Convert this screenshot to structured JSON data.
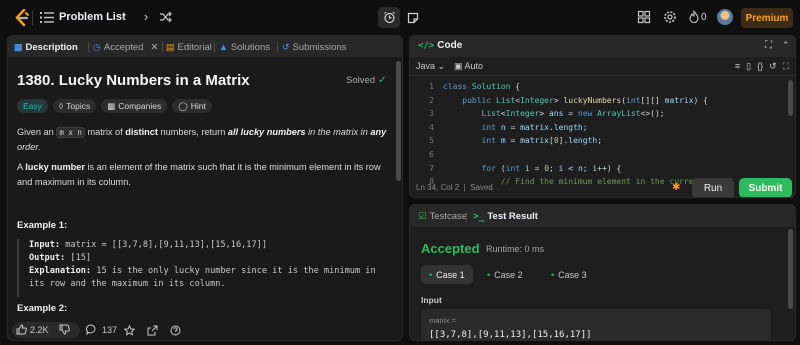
{
  "topbar": {
    "problem_list": "Problem List",
    "fire_count": "0",
    "premium": "Premium"
  },
  "left": {
    "tabs": [
      {
        "label": "Description",
        "icon": "description-icon"
      },
      {
        "label": "Accepted",
        "icon": "clock-icon"
      },
      {
        "label": "Editorial",
        "icon": "book-icon"
      },
      {
        "label": "Solutions",
        "icon": "flask-icon"
      },
      {
        "label": "Submissions",
        "icon": "history-icon"
      }
    ],
    "title": "1380. Lucky Numbers in a Matrix",
    "solved": "Solved",
    "chips": [
      "Easy",
      "Topics",
      "Companies",
      "Hint"
    ],
    "desc1": {
      "a": "Given an ",
      "code": "m x n",
      "b": " matrix of ",
      "bold1": "distinct",
      "c": " numbers, return ",
      "it1": "all",
      "bold2": "lucky numbers",
      "d": " in the matrix in ",
      "bold3": "any",
      "e": "order."
    },
    "desc2": {
      "a": "A ",
      "bold": "lucky number",
      "b": " is an element of the matrix such that it is the minimum element in its row and maximum in its column."
    },
    "example1": {
      "title": "Example 1:",
      "input_label": "Input:",
      "input_value": " matrix = [[3,7,8],[9,11,13],[15,16,17]]",
      "output_label": "Output:",
      "output_value": " [15]",
      "expl_label": "Explanation:",
      "expl_value": " 15 is the only lucky number since it is the minimum in",
      "expl_value2": "its row and the maximum in its column."
    },
    "example2_title": "Example 2:",
    "footer": {
      "likes": "2.2K",
      "comments": "137"
    }
  },
  "code": {
    "title": "Code",
    "lang": "Java",
    "auto": "Auto",
    "lines": [
      {
        "n": "1",
        "html": "<span class=\"kw\">class</span> <span class=\"ty\">Solution</span> {"
      },
      {
        "n": "2",
        "html": "    <span class=\"kw\">public</span> <span class=\"ty\">List</span>&lt;<span class=\"ty\">Integer</span>&gt; <span class=\"fn\">luckyNumbers</span>(<span class=\"kw\">int</span>[][] <span class=\"vr\">matrix</span>) {"
      },
      {
        "n": "3",
        "html": "        <span class=\"ty\">List</span>&lt;<span class=\"ty\">Integer</span>&gt; <span class=\"vr\">ans</span> = <span class=\"kw\">new</span> <span class=\"ty\">ArrayList</span>&lt;&gt;();"
      },
      {
        "n": "4",
        "html": "        <span class=\"kw\">int</span> <span class=\"vr\">n</span> = <span class=\"vr\">matrix</span>.<span class=\"vr\">length</span>;"
      },
      {
        "n": "5",
        "html": "        <span class=\"kw\">int</span> <span class=\"vr\">m</span> = <span class=\"vr\">matrix</span>[<span class=\"nm\">0</span>].<span class=\"vr\">length</span>;"
      },
      {
        "n": "6",
        "html": ""
      },
      {
        "n": "7",
        "html": "        <span class=\"kw\">for</span> (<span class=\"kw\">int</span> <span class=\"vr\">i</span> = <span class=\"nm\">0</span>; <span class=\"vr\">i</span> &lt; <span class=\"vr\">n</span>; <span class=\"vr\">i</span>++) {"
      },
      {
        "n": "8",
        "html": "            <span class=\"cm\">// Find the minimum element in the current row</span>"
      }
    ],
    "position": "Ln 34, Col 2",
    "saved": "Saved",
    "run": "Run",
    "submit": "Submit"
  },
  "result": {
    "tabs": [
      {
        "label": "Testcase"
      },
      {
        "label": "Test Result"
      }
    ],
    "status": "Accepted",
    "runtime": "Runtime: 0 ms",
    "cases": [
      "Case 1",
      "Case 2",
      "Case 3"
    ],
    "input_label": "Input",
    "var_name": "matrix =",
    "var_value": "[[3,7,8],[9,11,13],[15,16,17]]"
  },
  "colors": {
    "accent_green": "#2cbb5d",
    "premium_orange": "#ffa116",
    "easy_teal": "#1cbaba"
  }
}
